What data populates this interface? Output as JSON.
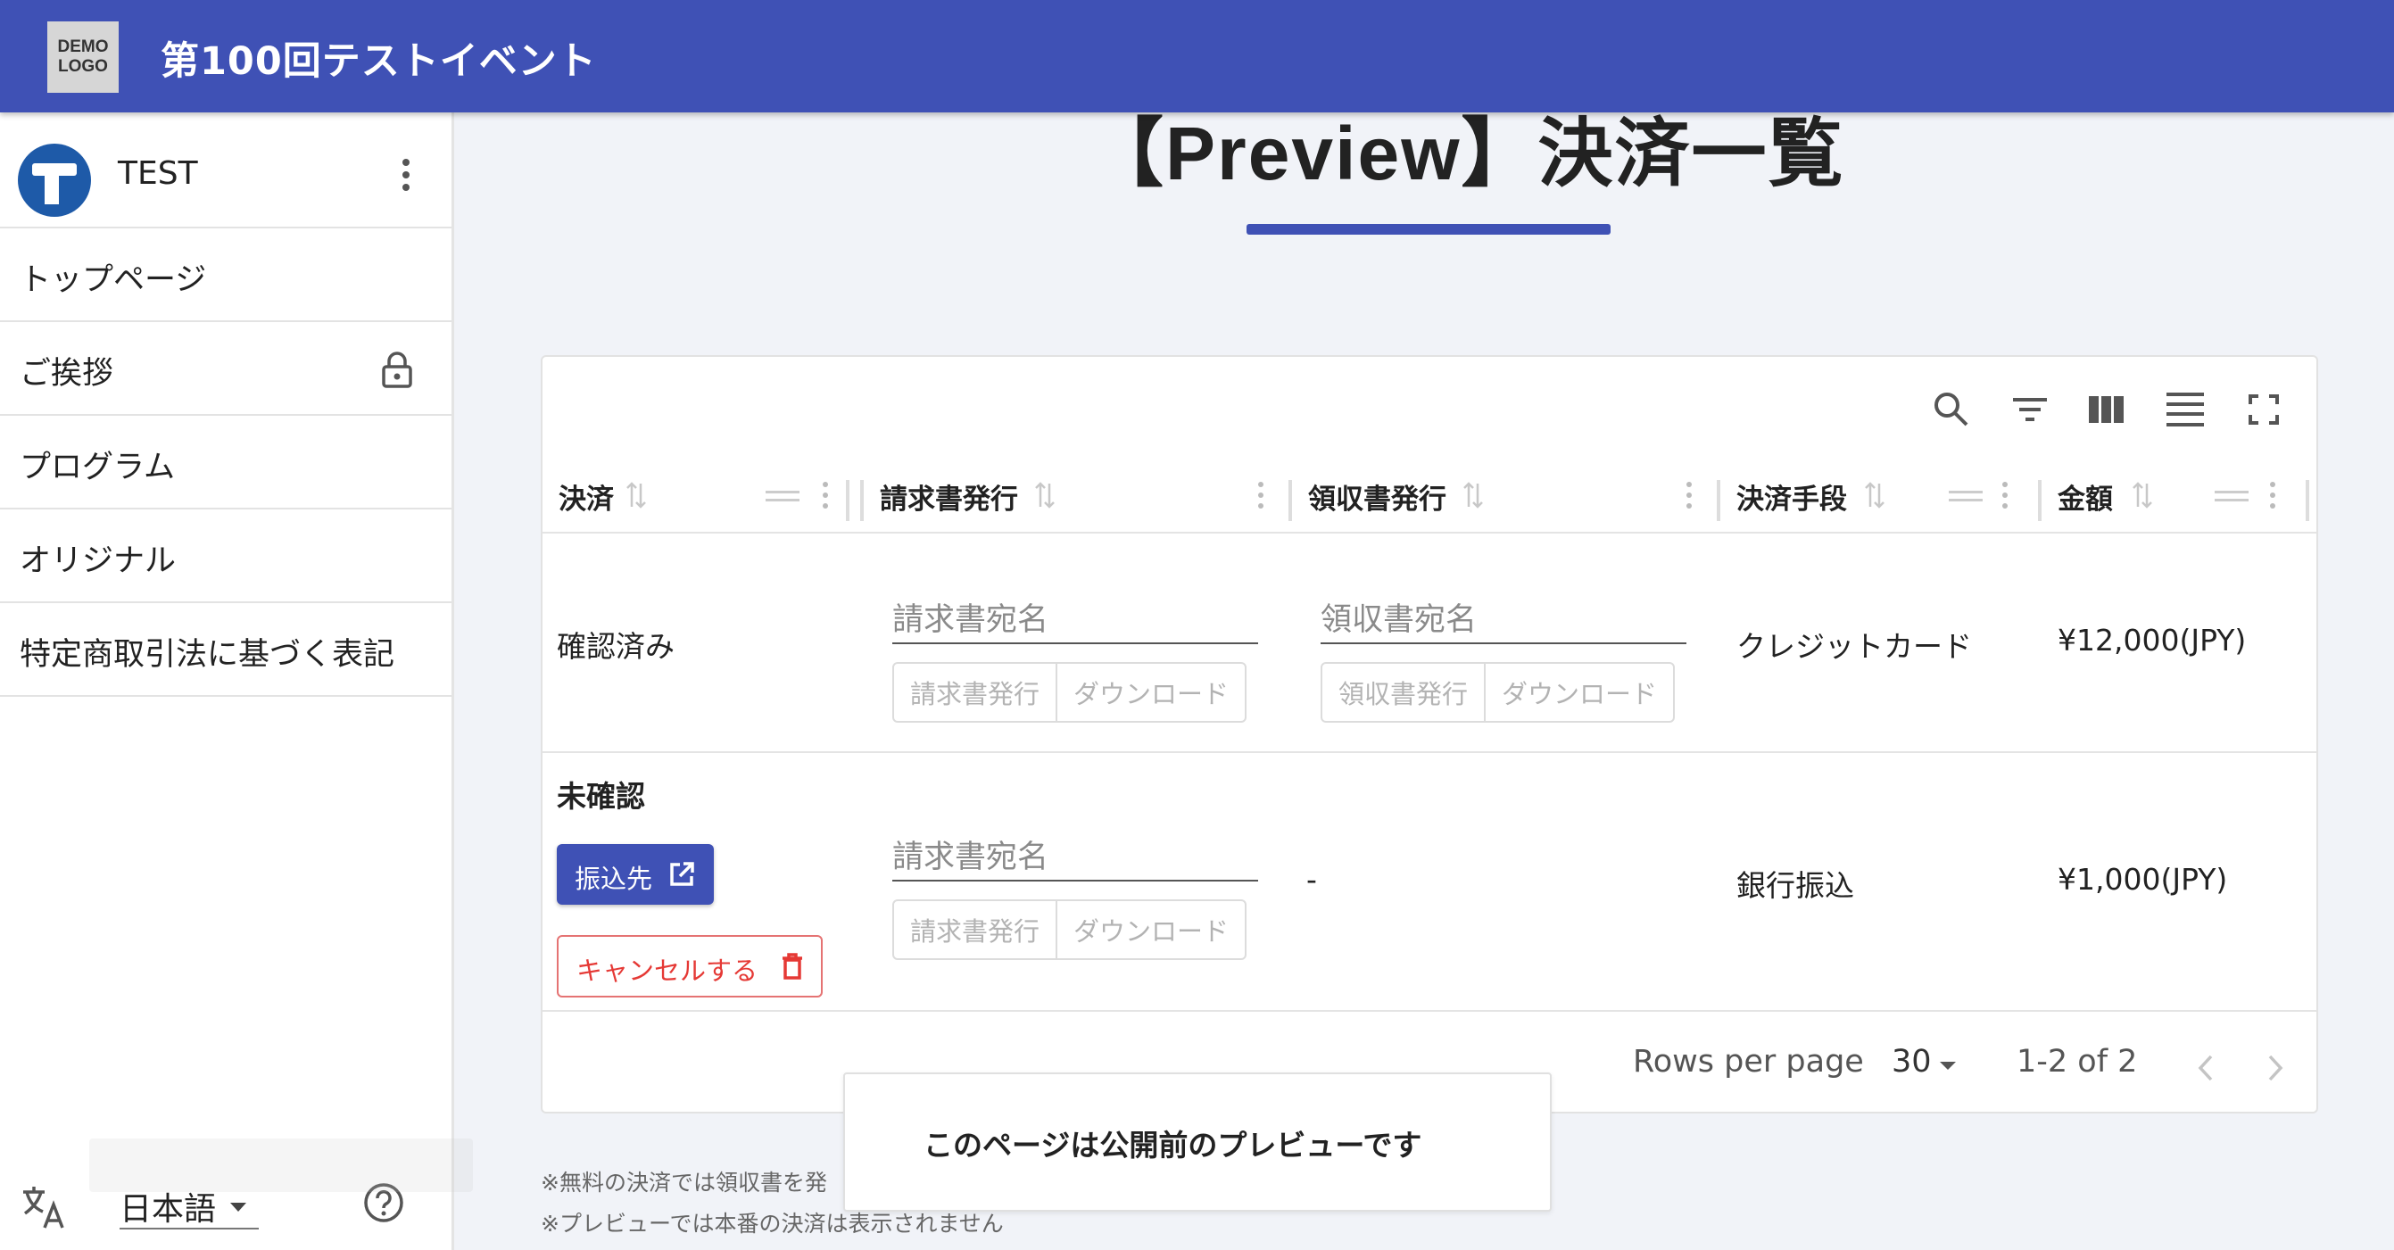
{
  "header": {
    "logo_line1": "DEMO",
    "logo_line2": "LOGO",
    "event_title": "第100回テストイベント",
    "bar_color": "#3f51b5"
  },
  "sidebar": {
    "account_name": "TEST",
    "menu_icon": "more-vert-icon",
    "items": [
      {
        "label": "トップページ"
      },
      {
        "label": "ご挨拶",
        "icon": "lock-icon"
      },
      {
        "label": "プログラム"
      },
      {
        "label": "オリジナル"
      },
      {
        "label": "特定商取引法に基づく表記"
      }
    ],
    "language": "日本語",
    "translate_icon": "translate-icon",
    "help_icon": "help-icon"
  },
  "main": {
    "title": "【Preview】決済一覧",
    "toolbar_icons": [
      "search-icon",
      "filter-icon",
      "columns-icon",
      "density-icon",
      "fullscreen-icon"
    ],
    "columns": [
      "決済",
      "請求書発行",
      "領収書発行",
      "決済手段",
      "金額"
    ],
    "rows": [
      {
        "status": "確認済み",
        "invoice_placeholder": "請求書宛名",
        "invoice_issue": "請求書発行",
        "invoice_download": "ダウンロード",
        "receipt_placeholder": "領収書宛名",
        "receipt_issue": "領収書発行",
        "receipt_download": "ダウンロード",
        "method": "クレジットカード",
        "amount": "¥12,000(JPY)"
      },
      {
        "status": "未確認",
        "transfer_button": "振込先",
        "cancel_button": "キャンセルする",
        "invoice_placeholder": "請求書宛名",
        "invoice_issue": "請求書発行",
        "invoice_download": "ダウンロード",
        "receipt": "-",
        "method": "銀行振込",
        "amount": "¥1,000(JPY)"
      }
    ],
    "pagination": {
      "rows_per_page_label": "Rows per page",
      "rows_per_page": "30",
      "range": "1-2 of 2"
    },
    "footnotes": [
      "※無料の決済では領収書を発",
      "※プレビューでは本番の決済は表示されません"
    ]
  },
  "preview_notice": "このページは公開前のプレビューです"
}
